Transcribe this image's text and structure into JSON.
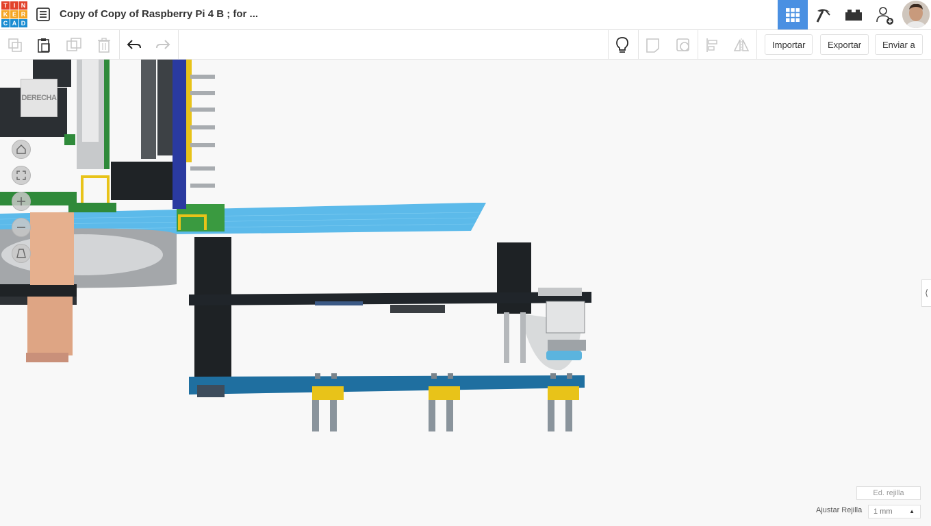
{
  "app": {
    "logo_letters": [
      "T",
      "I",
      "N",
      "K",
      "E",
      "R",
      "C",
      "A",
      "D"
    ],
    "logo_colors": [
      "#e2412a",
      "#e2412a",
      "#e2412a",
      "#f5a623",
      "#f5a623",
      "#f5a623",
      "#1b8dd2",
      "#1b8dd2",
      "#1b8dd2"
    ],
    "title": "Copy of Copy of Raspberry Pi 4 B ; for ..."
  },
  "header_buttons": [
    {
      "name": "3d-design-view-icon",
      "active": true
    },
    {
      "name": "pickaxe-icon",
      "active": false
    },
    {
      "name": "bricks-icon",
      "active": false
    },
    {
      "name": "add-user-icon",
      "active": false
    }
  ],
  "toolbar": {
    "import_label": "Importar",
    "export_label": "Exportar",
    "send_label": "Enviar a"
  },
  "viewport": {
    "viewcube_label": "DERECHA",
    "edit_grid_label": "Ed. rejilla",
    "snap_label": "Ajustar Rejilla",
    "snap_value": "1 mm"
  },
  "colors": {
    "accent": "#4a90e2",
    "workplane": "#4ab2e8",
    "pcb_green": "#2f8a3a",
    "pcb_blue": "#1f6fa0",
    "header_yellow": "#e8c319"
  }
}
